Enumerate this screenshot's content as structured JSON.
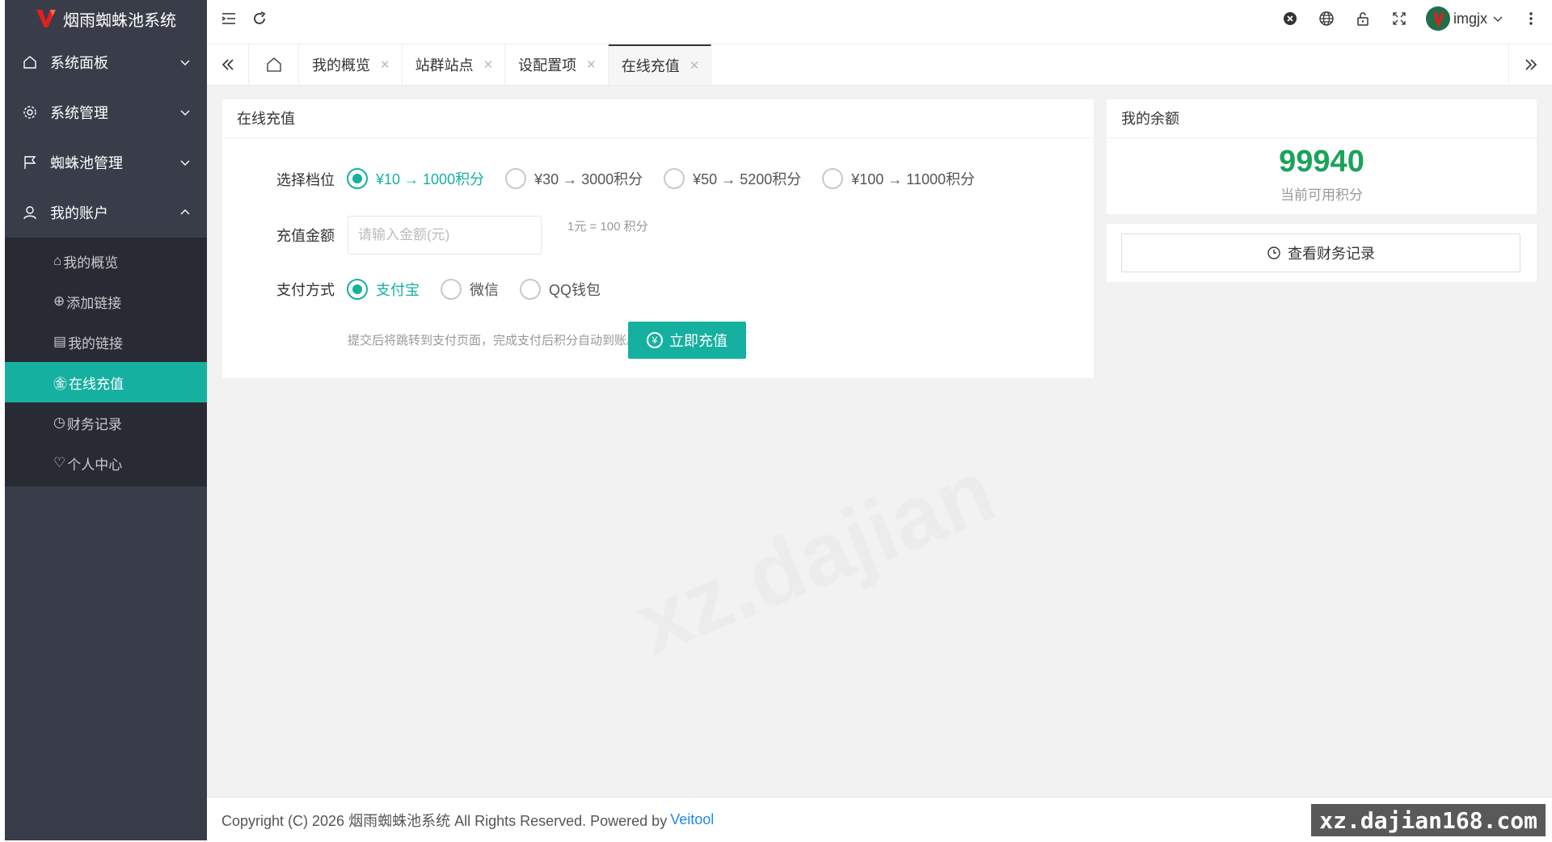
{
  "app": {
    "title": "烟雨蜘蛛池系统"
  },
  "sidebar": {
    "items": [
      {
        "label": "系统面板",
        "icon": "home-icon"
      },
      {
        "label": "系统管理",
        "icon": "gear-icon"
      },
      {
        "label": "蜘蛛池管理",
        "icon": "flag-icon"
      },
      {
        "label": "我的账户",
        "icon": "user-icon"
      }
    ],
    "sub_items": [
      {
        "label": "我的概览",
        "glyph": "⌂"
      },
      {
        "label": "添加链接",
        "glyph": "⊕"
      },
      {
        "label": "我的链接",
        "glyph": "▤"
      },
      {
        "label": "在线充值",
        "glyph": "㊎"
      },
      {
        "label": "财务记录",
        "glyph": "◷"
      },
      {
        "label": "个人中心",
        "glyph": "♡"
      }
    ]
  },
  "header": {
    "username": "imgjx"
  },
  "tabs": [
    {
      "label": "我的概览"
    },
    {
      "label": "站群站点"
    },
    {
      "label": "设配置项"
    },
    {
      "label": "在线充值"
    }
  ],
  "recharge": {
    "title": "在线充值",
    "tier_label": "选择档位",
    "tiers": [
      "¥10 → 1000积分",
      "¥30 → 3000积分",
      "¥50 → 5200积分",
      "¥100 → 11000积分"
    ],
    "amount_label": "充值金额",
    "amount_placeholder": "请输入金额(元)",
    "rate_hint": "1元 = 100 积分",
    "payment_label": "支付方式",
    "payment_methods": [
      "支付宝",
      "微信",
      "QQ钱包"
    ],
    "submit_hint": "提交后将跳转到支付页面，完成支付后积分自动到账。",
    "submit_label": "立即充值"
  },
  "balance": {
    "title": "我的余额",
    "value": "99940",
    "caption": "当前可用积分",
    "records_button": "查看财务记录"
  },
  "footer": {
    "copyright": "Copyright (C) 2026 烟雨蜘蛛池系统 All Rights Reserved. Powered by",
    "link": "Veitool",
    "site_badge": "xz.dajian168.com"
  },
  "colors": {
    "accent": "#16b0a0",
    "sidebar": "#393d49",
    "submenu": "#282b33",
    "balance": "#1aa35b"
  }
}
